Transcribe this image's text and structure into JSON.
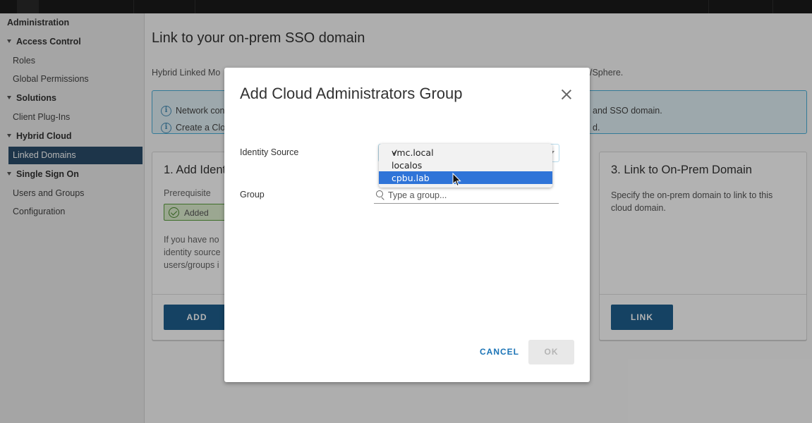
{
  "sidebar": {
    "title": "Administration",
    "groups": [
      {
        "label": "Access Control",
        "items": [
          "Roles",
          "Global Permissions"
        ]
      },
      {
        "label": "Solutions",
        "items": [
          "Client Plug-Ins"
        ]
      },
      {
        "label": "Hybrid Cloud",
        "items": [
          "Linked Domains"
        ]
      },
      {
        "label": "Single Sign On",
        "items": [
          "Users and Groups",
          "Configuration"
        ]
      }
    ],
    "active_item": "Linked Domains"
  },
  "page": {
    "title": "Link to your on-prem SSO domain",
    "description_left": "Hybrid Linked Mo",
    "description_right": "/Sphere.",
    "alert": {
      "line1_left": "Network con",
      "line1_right": "and SSO domain.",
      "line2_left": "Create a Clo",
      "line2_right": "d."
    },
    "cards": [
      {
        "title": "1. Add Ident",
        "prerequisite_label": "Prerequisite",
        "badge": "Added",
        "body_lines": [
          "If you have no",
          "identity source",
          "users/groups i"
        ],
        "button": "ADD"
      },
      {
        "title": "3. Link to On-Prem Domain",
        "body_lines": [
          "Specify the on-prem domain to link to this",
          "cloud domain."
        ],
        "button": "LINK"
      }
    ]
  },
  "modal": {
    "title": "Add Cloud Administrators Group",
    "identity_source_label": "Identity Source",
    "group_label": "Group",
    "group_placeholder": "Type a group...",
    "cancel": "CANCEL",
    "ok": "OK",
    "dropdown": {
      "options": [
        "vmc.local",
        "localos",
        "cpbu.lab"
      ],
      "checked": "vmc.local",
      "highlighted": "cpbu.lab",
      "check_mark": "✓"
    }
  },
  "colors": {
    "sidebar_active": "#2a4d6b",
    "primary_button": "#1f5f8f",
    "alert_background": "#e1f1f6",
    "dropdown_highlight": "#2f74d8"
  }
}
